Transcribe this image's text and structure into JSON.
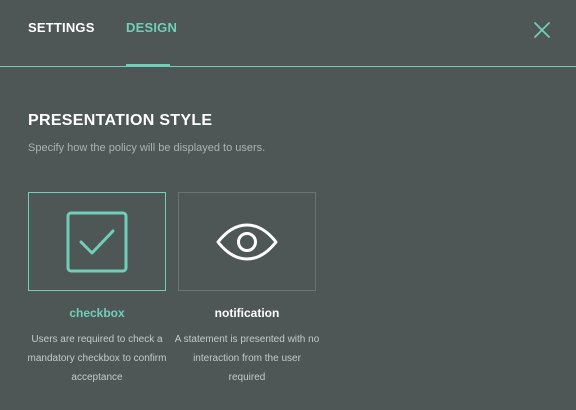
{
  "header": {
    "tabs": [
      {
        "label": "SETTINGS",
        "active": false
      },
      {
        "label": "DESIGN",
        "active": true
      }
    ],
    "close_icon": "close-icon"
  },
  "section": {
    "title": "PRESENTATION STYLE",
    "description": "Specify how the policy will be displayed to users."
  },
  "options": [
    {
      "id": "checkbox",
      "label": "checkbox",
      "description": "Users are required to check a mandatory checkbox to confirm acceptance",
      "icon": "checkbox-checked-icon",
      "selected": true
    },
    {
      "id": "notification",
      "label": "notification",
      "description": "A statement is presented with no interaction from the user required",
      "icon": "eye-icon",
      "selected": false
    }
  ],
  "colors": {
    "background": "#4e5656",
    "accent": "#6fcfb8",
    "text": "#ffffff",
    "muted_text": "#aab3b2",
    "card_border": "#6a7372"
  }
}
